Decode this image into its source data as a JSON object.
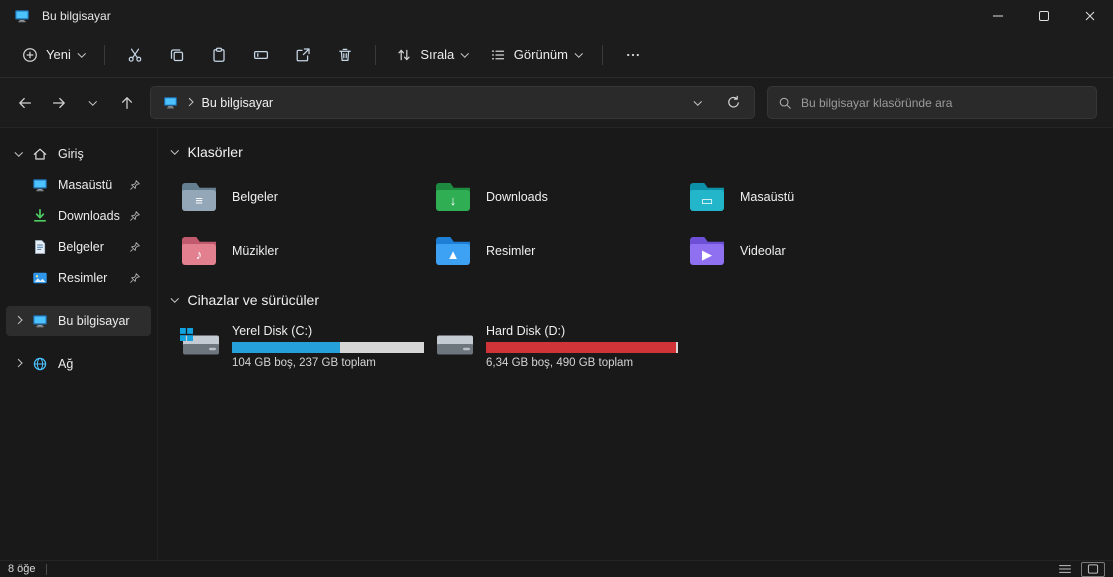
{
  "window": {
    "title": "Bu bilgisayar"
  },
  "toolbar": {
    "new_label": "Yeni",
    "sort_label": "Sırala",
    "view_label": "Görünüm"
  },
  "navbar": {
    "breadcrumb_root": "Bu bilgisayar",
    "search_placeholder": "Bu bilgisayar klasöründe ara"
  },
  "sidebar": {
    "items": [
      {
        "label": "Giriş",
        "pinned": false,
        "expanded": true
      },
      {
        "label": "Masaüstü",
        "pinned": true
      },
      {
        "label": "Downloads",
        "pinned": true
      },
      {
        "label": "Belgeler",
        "pinned": true
      },
      {
        "label": "Resimler",
        "pinned": true
      },
      {
        "label": "Bu bilgisayar",
        "pinned": false,
        "selected": true
      },
      {
        "label": "Ağ",
        "pinned": false
      }
    ]
  },
  "content": {
    "folders_section_title": "Klasörler",
    "drives_section_title": "Cihazlar ve sürücüler",
    "folders": [
      {
        "name": "Belgeler",
        "glyph": "≡",
        "front": "#93a7b8",
        "back": "#657e90"
      },
      {
        "name": "Downloads",
        "glyph": "↓",
        "front": "#2fae54",
        "back": "#1d8a3f"
      },
      {
        "name": "Masaüstü",
        "glyph": "▭",
        "front": "#23b5ca",
        "back": "#0d91a8"
      },
      {
        "name": "Müzikler",
        "glyph": "♪",
        "front": "#e2808f",
        "back": "#c25a6e"
      },
      {
        "name": "Resimler",
        "glyph": "▲",
        "front": "#3ea2f4",
        "back": "#1d7fd6"
      },
      {
        "name": "Videolar",
        "glyph": "▶",
        "front": "#8f70f0",
        "back": "#6e50d6"
      }
    ],
    "drives": [
      {
        "name": "Yerel Disk (C:)",
        "info": "104 GB boş, 237 GB toplam",
        "used_percent": "56%",
        "bar_color": "#26a0da",
        "track_color": "#d6d6d6",
        "system": true
      },
      {
        "name": "Hard Disk (D:)",
        "info": "6,34 GB boş, 490 GB toplam",
        "used_percent": "98.7%",
        "bar_color": "#d13438",
        "track_color": "#d6d6d6",
        "system": false
      }
    ]
  },
  "statusbar": {
    "item_count": "8 öğe"
  },
  "icons": {
    "new": "plus-circle",
    "cut": "scissors",
    "copy": "copy",
    "paste": "clipboard",
    "rename": "rename-box",
    "share": "share-arrow",
    "delete": "trash",
    "sort": "arrows-up-down",
    "view": "list-bullets",
    "more": "ellipsis",
    "back": "arrow-left",
    "forward": "arrow-right",
    "recent": "chevron-down",
    "up": "arrow-up",
    "refresh": "refresh-arrow",
    "search": "magnifier",
    "pin": "pushpin",
    "home": "house",
    "desktop": "monitor",
    "downloads": "arrow-down-tray",
    "documents": "document-lines",
    "pictures": "photo",
    "this_pc": "monitor",
    "network": "globe",
    "drive": "hard-disk",
    "windows_logo": "four-pane-window"
  },
  "colors": {
    "chrome": "#1c1c1c",
    "content_bg": "#191919",
    "selection": "#2d2d2d",
    "accent": "#4cc2ff",
    "drive_used_c": "#26a0da",
    "drive_used_d": "#d13438",
    "drive_track": "#d6d6d6"
  }
}
